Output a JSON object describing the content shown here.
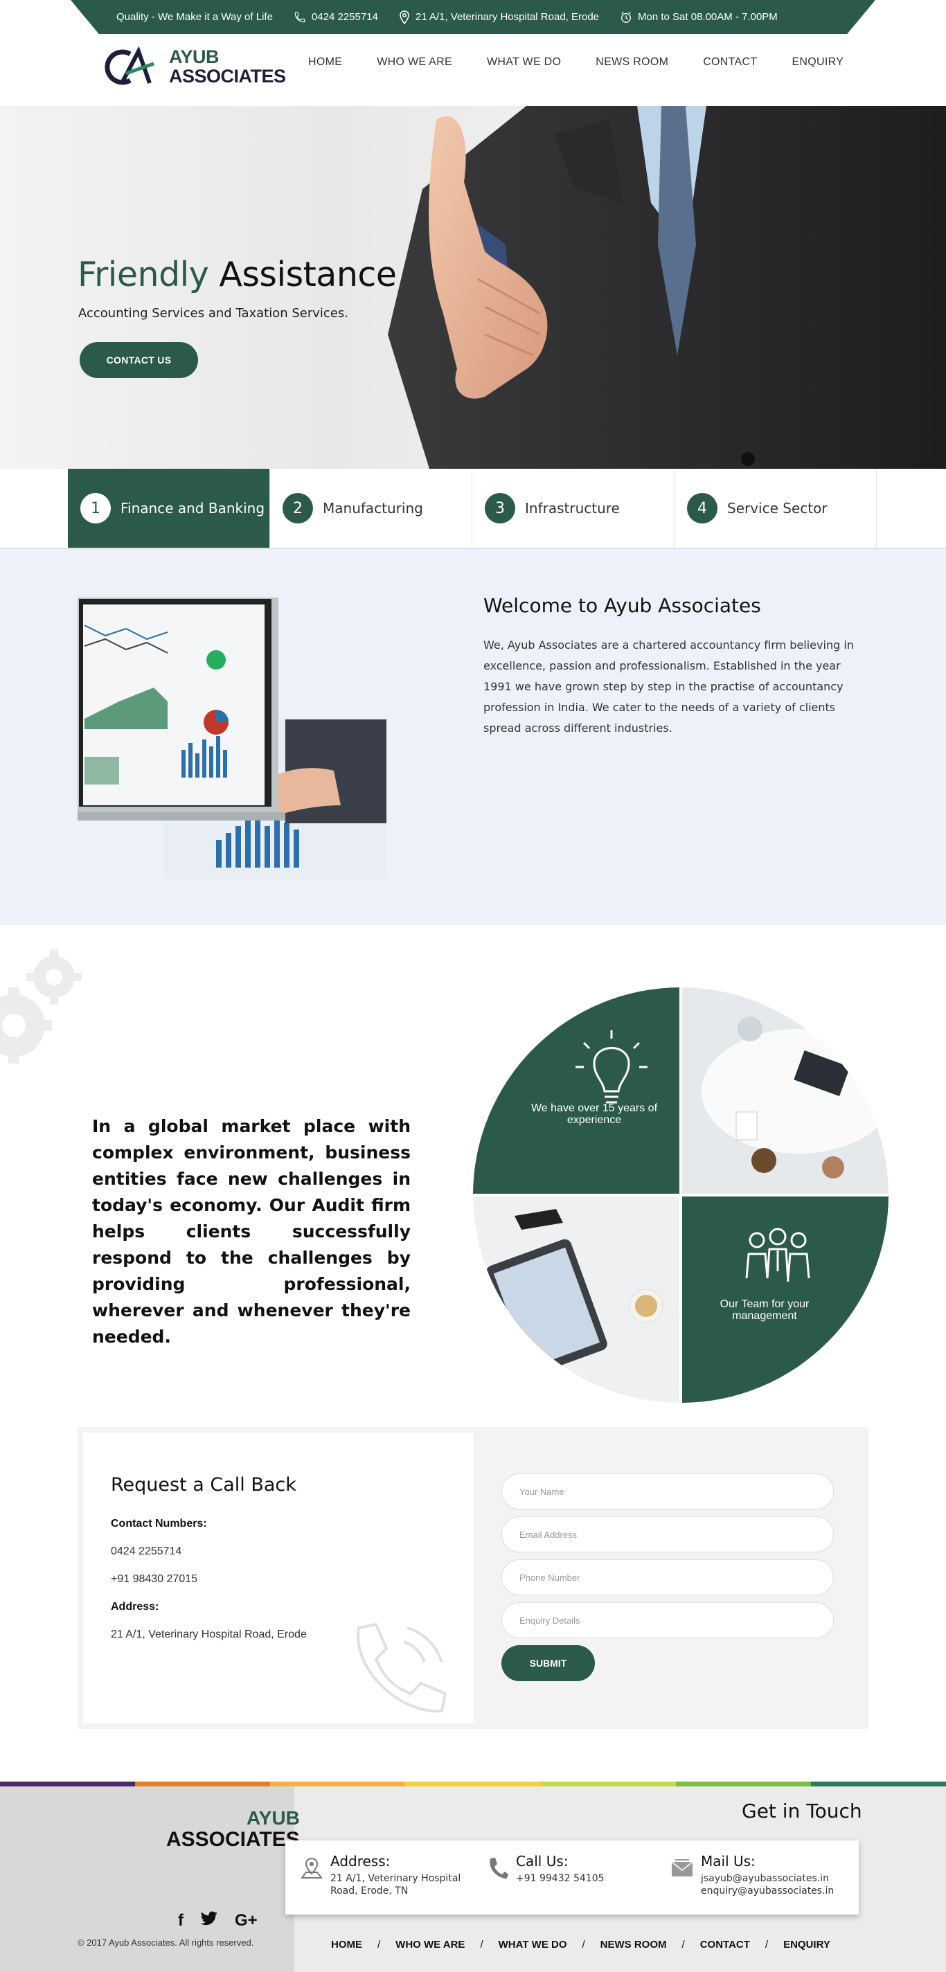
{
  "topbar": {
    "tagline": "Quality - We Make it a Way of Life",
    "phone": "0424 2255714",
    "address": "21 A/1, Veterinary Hospital Road, Erode",
    "hours": "Mon to Sat 08.00AM - 7.00PM"
  },
  "logo": {
    "word1": "AYUB",
    "word2": "ASSOCIATES"
  },
  "nav": [
    "HOME",
    "WHO WE ARE",
    "WHAT WE DO",
    "NEWS ROOM",
    "CONTACT",
    "ENQUIRY"
  ],
  "hero": {
    "title_green": "Friendly",
    "title_dark": "Assistance",
    "subtitle": "Accounting Services and Taxation Services.",
    "button": "CONTACT US"
  },
  "tabs": [
    {
      "num": "1",
      "label": "Finance and Banking"
    },
    {
      "num": "2",
      "label": "Manufacturing"
    },
    {
      "num": "3",
      "label": "Infrastructure"
    },
    {
      "num": "4",
      "label": "Service Sector"
    }
  ],
  "welcome": {
    "title": "Welcome to Ayub Associates",
    "body": "We, Ayub Associates are a chartered accountancy firm believing in excellence, passion and professionalism. Established in the year 1991 we have grown step by step in the practise of accountancy profession in India. We cater to the needs of a variety of clients spread across different industries."
  },
  "audit": {
    "text": "In a global market place with complex environment, business entities face new challenges in today's economy. Our Audit firm helps clients successfully respond to the challenges by providing professional, wherever and whenever they're needed.",
    "quad1": "We have over 15 years of experience",
    "quad2": "Our Team for your management"
  },
  "callback": {
    "title": "Request a Call Back",
    "contact_label": "Contact Numbers:",
    "phone1": "0424 2255714",
    "phone2": "+91 98430 27015",
    "address_label": "Address:",
    "address": "21 A/1, Veterinary Hospital Road, Erode",
    "fields": {
      "name": "Your Name",
      "email": "Email Address",
      "phone": "Phone Number",
      "details": "Enquiry Details"
    },
    "submit": "SUBMIT"
  },
  "footer": {
    "get_in_touch": "Get in Touch",
    "address_title": "Address:",
    "address_l1": "21 A/1, Veterinary Hospital",
    "address_l2": "Road, Erode, TN",
    "call_title": "Call Us:",
    "call_value": "+91 99432 54105",
    "mail_title": "Mail Us:",
    "mail1": "jsayub@ayubassociates.in",
    "mail2": "enquiry@ayubassociates.in",
    "logo1": "AYUB",
    "logo2": "ASSOCIATES",
    "copyright": "© 2017 Ayub Associates. All rights reserved.",
    "nav": [
      "HOME",
      "WHO WE ARE",
      "WHAT WE DO",
      "NEWS ROOM",
      "CONTACT",
      "ENQUIRY"
    ],
    "stripe_colors": [
      "#4b2a6b",
      "#e67e22",
      "#f5b041",
      "#f4d03f",
      "#c9d84a",
      "#7dbb42",
      "#2b7a5c"
    ]
  },
  "colors": {
    "accent": "#2b5a49",
    "dark": "#1d1f3a"
  }
}
